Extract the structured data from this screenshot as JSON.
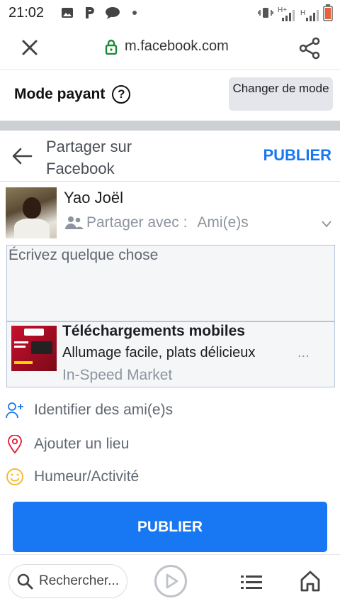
{
  "status_bar": {
    "time": "21:02",
    "icons": [
      "gallery-icon",
      "p-app-icon",
      "chat-bubble-icon",
      "notification-dot-icon",
      "vibrate-icon",
      "signal-h-plus-icon",
      "signal-h-icon",
      "battery-low-icon"
    ],
    "signal_labels": [
      "H+",
      "H"
    ]
  },
  "browser": {
    "url": "m.facebook.com",
    "secure_color": "#1a8a34"
  },
  "mode_bar": {
    "label": "Mode payant",
    "help_symbol": "?",
    "switch_label": "Changer de mode"
  },
  "composer": {
    "title": "Partager sur Facebook",
    "publish_link": "PUBLIER",
    "user_name": "Yao Joël",
    "audience_label": "Partager avec :",
    "audience_value": "Ami(e)s",
    "placeholder": "Écrivez quelque chose"
  },
  "link_preview": {
    "title": "Téléchargements mobiles",
    "description": "Allumage facile, plats délicieux",
    "ellipsis": "...",
    "source": "In-Speed Market"
  },
  "actions": [
    {
      "label": "Identifier des ami(e)s",
      "icon": "tag-friends-icon"
    },
    {
      "label": "Ajouter un lieu",
      "icon": "location-pin-icon"
    },
    {
      "label": "Humeur/Activité",
      "icon": "smiley-icon"
    }
  ],
  "publish_button": "PUBLIER",
  "bottom_nav": {
    "search_label": "Rechercher..."
  },
  "colors": {
    "accent": "#1877f2",
    "location": "#e41e3f",
    "tag": "#1877f2",
    "feeling": "#f7b928"
  }
}
